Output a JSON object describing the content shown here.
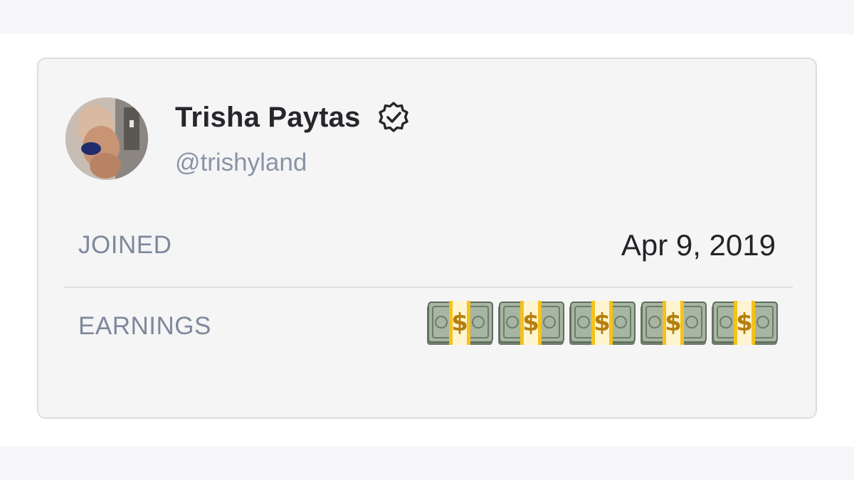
{
  "profile": {
    "name": "Trisha Paytas",
    "handle": "@trishyland",
    "verified": true,
    "avatar_alt": "profile-photo"
  },
  "details": {
    "joined_label": "JOINED",
    "joined_value": "Apr 9, 2019",
    "earnings_label": "EARNINGS",
    "earnings_value": "💵💵💵💵💵",
    "earnings_icon": "money-bag-emoji-icon",
    "earnings_icon_count": 5
  },
  "colors": {
    "card_bg": "#f5f5f6",
    "card_border": "#dcdde3",
    "name": "#26272b",
    "muted": "#7f889c",
    "handle": "#8b93a7",
    "value": "#232428",
    "money_green": "#8fa48a",
    "money_band": "#f2c21b"
  }
}
